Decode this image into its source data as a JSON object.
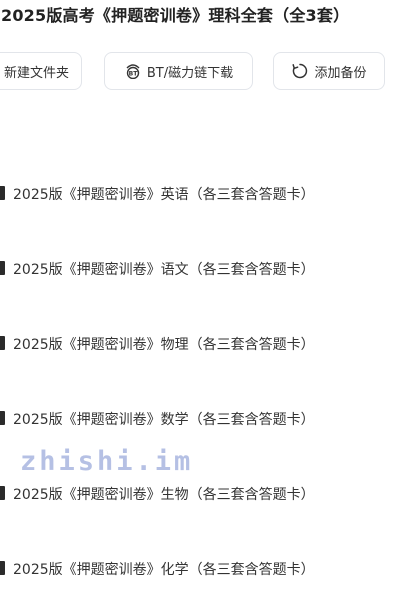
{
  "header": {
    "title": "2025版高考《押题密训卷》理科全套（全3套）"
  },
  "toolbar": {
    "new_folder_label": "新建文件夹",
    "bt_download_label": "BT/磁力链下载",
    "add_backup_label": "添加备份"
  },
  "icons": {
    "bt": "bt-icon",
    "backup": "refresh-icon",
    "file": "file-icon"
  },
  "files": [
    {
      "name": "2025版《押题密训卷》英语（各三套含答题卡）"
    },
    {
      "name": "2025版《押题密训卷》语文（各三套含答题卡）"
    },
    {
      "name": "2025版《押题密训卷》物理（各三套含答题卡）"
    },
    {
      "name": "2025版《押题密训卷》数学（各三套含答题卡）"
    },
    {
      "name": "2025版《押题密训卷》生物（各三套含答题卡）"
    },
    {
      "name": "2025版《押题密训卷》化学（各三套含答题卡）"
    }
  ],
  "watermark": {
    "text": "zhishi.im"
  }
}
